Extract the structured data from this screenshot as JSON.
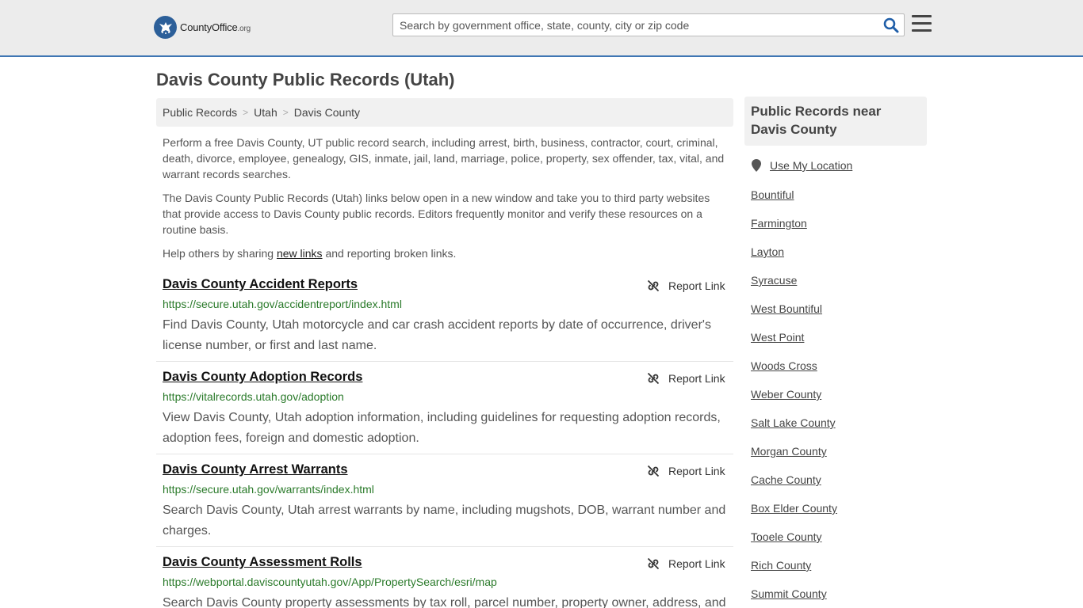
{
  "header": {
    "logo_main": "CountyOffice",
    "logo_tld": ".org",
    "search_placeholder": "Search by government office, state, county, city or zip code"
  },
  "page_title": "Davis County Public Records (Utah)",
  "breadcrumb": [
    "Public Records",
    "Utah",
    "Davis County"
  ],
  "intro": {
    "p1": "Perform a free Davis County, UT public record search, including arrest, birth, business, contractor, court, criminal, death, divorce, employee, genealogy, GIS, inmate, jail, land, marriage, police, property, sex offender, tax, vital, and warrant records searches.",
    "p2": "The Davis County Public Records (Utah) links below open in a new window and take you to third party websites that provide access to Davis County public records. Editors frequently monitor and verify these resources on a routine basis.",
    "p3_before": "Help others by sharing ",
    "p3_link": "new links",
    "p3_after": " and reporting broken links."
  },
  "report_label": "Report Link",
  "records": [
    {
      "title": "Davis County Accident Reports",
      "url": "https://secure.utah.gov/accidentreport/index.html",
      "desc": "Find Davis County, Utah motorcycle and car crash accident reports by date of occurrence, driver's license number, or first and last name."
    },
    {
      "title": "Davis County Adoption Records",
      "url": "https://vitalrecords.utah.gov/adoption",
      "desc": "View Davis County, Utah adoption information, including guidelines for requesting adoption records, adoption fees, foreign and domestic adoption."
    },
    {
      "title": "Davis County Arrest Warrants",
      "url": "https://secure.utah.gov/warrants/index.html",
      "desc": "Search Davis County, Utah arrest warrants by name, including mugshots, DOB, warrant number and charges."
    },
    {
      "title": "Davis County Assessment Rolls",
      "url": "https://webportal.daviscountyutah.gov/App/PropertySearch/esri/map",
      "desc": "Search Davis County property assessments by tax roll, parcel number, property owner, address, and"
    }
  ],
  "sidebar": {
    "heading": "Public Records near Davis County",
    "use_location": "Use My Location",
    "links": [
      "Bountiful",
      "Farmington",
      "Layton",
      "Syracuse",
      "West Bountiful",
      "West Point",
      "Woods Cross",
      "Weber County",
      "Salt Lake County",
      "Morgan County",
      "Cache County",
      "Box Elder County",
      "Tooele County",
      "Rich County",
      "Summit County"
    ]
  },
  "colors": {
    "header_bg": "#ececec",
    "header_border": "#3f76b3",
    "logo_blue": "#2c5f99",
    "url_green": "#2a7a2a",
    "search_icon": "#1f5ea8"
  }
}
